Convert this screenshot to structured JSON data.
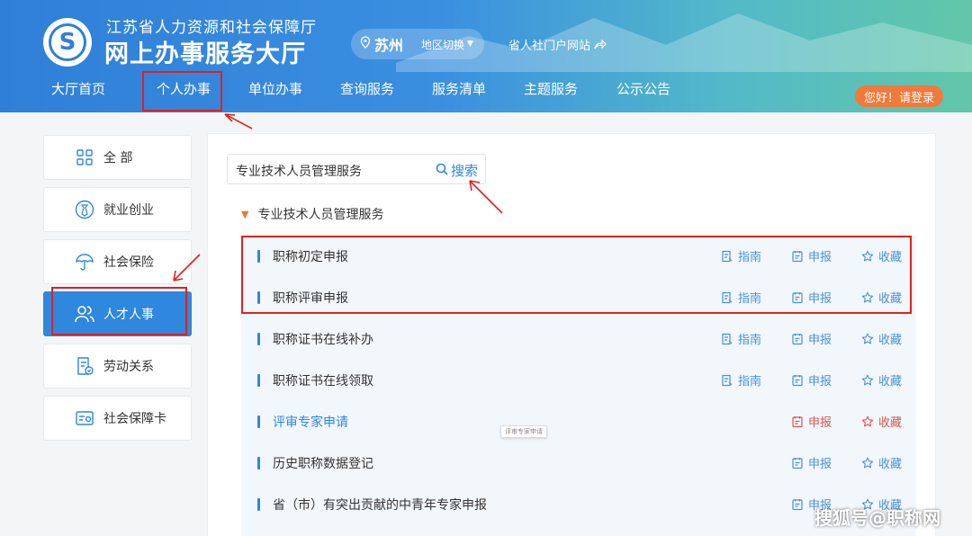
{
  "header": {
    "org_name": "江苏省人力资源和社会保障厅",
    "hall_name": "网上办事服务大厅",
    "city": "苏州",
    "city_switch": "地区切换",
    "portal_link": "省人社门户网站",
    "login": "您好！请登录",
    "logo_text": "S"
  },
  "nav": [
    {
      "label": "大厅首页"
    },
    {
      "label": "个人办事"
    },
    {
      "label": "单位办事"
    },
    {
      "label": "查询服务"
    },
    {
      "label": "服务清单"
    },
    {
      "label": "主题服务"
    },
    {
      "label": "公示公告"
    }
  ],
  "sidebar": [
    {
      "label": "全 部",
      "icon": "grid-icon"
    },
    {
      "label": "就业创业",
      "icon": "employment-icon"
    },
    {
      "label": "社会保险",
      "icon": "umbrella-icon"
    },
    {
      "label": "人才人事",
      "icon": "people-icon",
      "active": true
    },
    {
      "label": "劳动关系",
      "icon": "document-icon"
    },
    {
      "label": "社会保障卡",
      "icon": "card-icon"
    }
  ],
  "search": {
    "value": "专业技术人员管理服务",
    "button": "搜索"
  },
  "section_title": "专业技术人员管理服务",
  "actions": {
    "guide": "指南",
    "apply": "申报",
    "favorite": "收藏"
  },
  "rows": [
    {
      "title": "职称初定申报",
      "guide": true
    },
    {
      "title": "职称评审申报",
      "guide": true
    },
    {
      "title": "职称证书在线补办",
      "guide": true
    },
    {
      "title": "职称证书在线领取",
      "guide": true
    },
    {
      "title": "评审专家申请",
      "guide": false,
      "highlight": true
    },
    {
      "title": "历史职称数据登记",
      "guide": false
    },
    {
      "title": "省（市）有突出贡献的中青年专家申报",
      "guide": false
    }
  ],
  "tooltip": "评审专家申请",
  "watermark": "搜狐号@职称网",
  "colors": {
    "primary": "#2f87de",
    "accent_orange": "#f07a3c",
    "annotation_red": "#e02020",
    "hover_red": "#e0524a"
  }
}
